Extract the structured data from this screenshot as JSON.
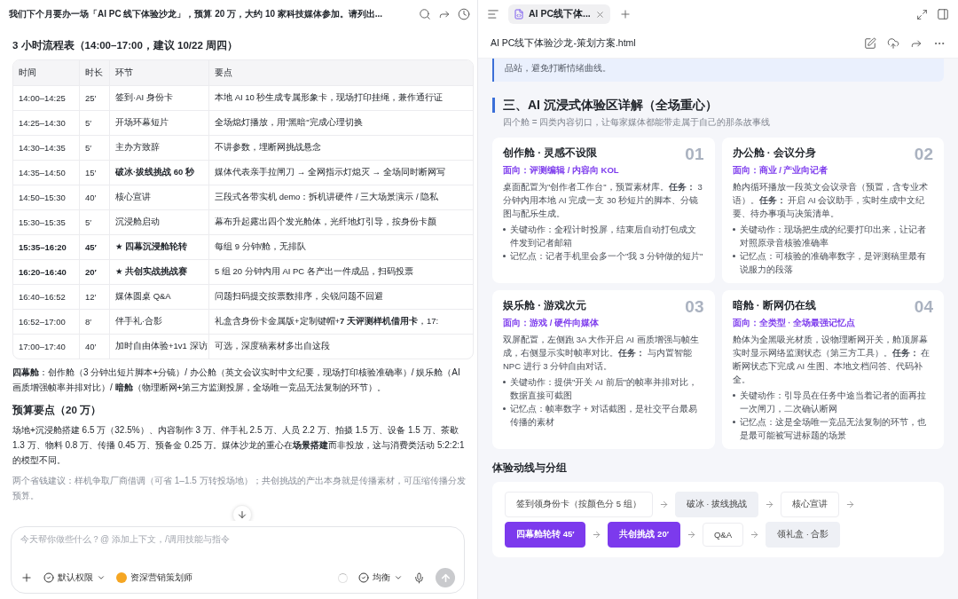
{
  "chat": {
    "title": "我们下个月要办一场「AI PC 线下体验沙龙」，预算 20 万，大约 10 家科技媒体参加。请列出...",
    "schedule_heading": "3 小时流程表（14:00–17:00，建议 10/22 周四）",
    "table": {
      "columns": [
        "时间",
        "时长",
        "环节",
        "要点"
      ],
      "rows": [
        {
          "time": "14:00–14:25",
          "duration": "25′",
          "step": "签到·AI 身份卡",
          "points": "本地 AI 10 秒生成专属形象卡，现场打印挂绳，兼作通行证",
          "highlight": false,
          "step_bold": false
        },
        {
          "time": "14:25–14:30",
          "duration": "5′",
          "step": "开场环幕短片",
          "points": "全场熄灯播放，用\"黑暗\"完成心理切换",
          "highlight": false,
          "step_bold": false
        },
        {
          "time": "14:30–14:35",
          "duration": "5′",
          "step": "主办方致辞",
          "points": "不讲参数，埋断网挑战悬念",
          "highlight": false,
          "step_bold": false
        },
        {
          "time": "14:35–14:50",
          "duration": "15′",
          "step": "破冰·拔线挑战 60 秒",
          "points": "媒体代表亲手拉闸刀 → 全网指示灯熄灭 → 全场同时断网写",
          "highlight": false,
          "step_bold": true
        },
        {
          "time": "14:50–15:30",
          "duration": "40′",
          "step": "核心宣讲",
          "points": "三段式各带实机 demo：拆机讲硬件 / 三大场景演示 / 隐私",
          "highlight": false,
          "step_bold": false
        },
        {
          "time": "15:30–15:35",
          "duration": "5′",
          "step": "沉浸舱启动",
          "points": "幕布升起露出四个发光舱体，光纤地灯引导，按身份卡颜",
          "highlight": false,
          "step_bold": false
        },
        {
          "time": "15:35–16:20",
          "duration": "45′",
          "step": "★ 四幕沉浸舱轮转",
          "points": "每组 9 分钟/舱，无排队",
          "highlight": true,
          "step_bold": true
        },
        {
          "time": "16:20–16:40",
          "duration": "20′",
          "step": "★ 共创实战挑战赛",
          "points": "5 组 20 分钟内用 AI PC 各产出一件成品，扫码投票",
          "highlight": true,
          "step_bold": true
        },
        {
          "time": "16:40–16:52",
          "duration": "12′",
          "step": "媒体圆桌 Q&A",
          "points": "问题扫码提交按票数排序，尖锐问题不回避",
          "highlight": false,
          "step_bold": false
        },
        {
          "time": "16:52–17:00",
          "duration": "8′",
          "step": "伴手礼·合影",
          "points": "礼盒含身份卡金属版+定制键帽+**7 天评测样机借用卡**，17:",
          "highlight": false,
          "step_bold": false
        },
        {
          "time": "17:00–17:40",
          "duration": "40′",
          "step": "加时自由体验+1v1 深访",
          "points": "可选，深度稿素材多出自这段",
          "highlight": false,
          "step_bold": false
        }
      ]
    },
    "cabins_note": "**四幕舱**：创作舱（3 分钟出短片脚本+分镜）/ 办公舱（英文会议实时中文纪要，现场打印核验准确率）/ 娱乐舱（AI 画质增强帧率并排对比）/ **暗舱**（物理断网+第三方监测投屏，全场唯一竞品无法复制的环节）。",
    "budget_heading": "预算要点（20 万）",
    "budget_text": "场地+沉浸舱搭建 6.5 万（32.5%）、内容制作 3 万、伴手礼 2.5 万、人员 2.2 万、拍摄 1.5 万、设备 1.5 万、茶歇 1.3 万、物料 0.8 万、传播 0.45 万、预备金 0.25 万。媒体沙龙的重心在**场景搭建**而非投放，这与消费类活动 5:2:2:1 的模型不同。",
    "tip_text": "两个省钱建议：样机争取厂商借调（可省 1–1.5 万转投场地）；共创挑战的产出本身就是传播素材，可压缩传播分发预算。",
    "input": {
      "placeholder": "今天帮你做些什么？@ 添加上下文，/调用技能与指令",
      "permission": "默认权限",
      "agent": "资深营销策划师",
      "mode": "均衡"
    }
  },
  "viewer": {
    "tabs": [
      {
        "label": "AI PC线下体...",
        "selected": true
      }
    ],
    "file_name": "AI PC线下体验沙龙-策划方案.html",
    "callout": "品站，避免打断情绪曲线。",
    "section_title": "三、AI 沉浸式体验区详解（全场重心）",
    "section_subtitle": "四个舱 = 四类内容切口，让每家媒体都能带走属于自己的那条故事线",
    "cards": [
      {
        "title": "创作舱 · 灵感不设限",
        "number": "01",
        "audience": "面向：评测编辑 / 内容向 KOL",
        "body": "桌面配置为\"创作者工作台\"，预置素材库。**任务：** 3 分钟内用本地 AI 完成一支 30 秒短片的脚本、分镜图与配乐生成。",
        "bullets": [
          "关键动作：全程计时投屏，结束后自动打包成文件发到记者邮箱",
          "记忆点：记者手机里会多一个\"我 3 分钟做的短片\""
        ]
      },
      {
        "title": "办公舱 · 会议分身",
        "number": "02",
        "audience": "面向：商业 / 产业向记者",
        "body": "舱内循环播放一段英文会议录音（预置，含专业术语）。**任务：** 开启 AI 会议助手，实时生成中文纪要、待办事项与决策清单。",
        "bullets": [
          "关键动作：现场把生成的纪要打印出来，让记者对照原录音核验准确率",
          "记忆点：可核验的准确率数字，是评测稿里最有说服力的段落"
        ]
      },
      {
        "title": "娱乐舱 · 游戏次元",
        "number": "03",
        "audience": "面向：游戏 / 硬件向媒体",
        "body": "双屏配置，左侧跑 3A 大作开启 AI 画质增强与帧生成，右侧显示实时帧率对比。**任务：** 与内置智能 NPC 进行 3 分钟自由对话。",
        "bullets": [
          "关键动作：提供\"开关 AI 前后\"的帧率并排对比，数据直接可截图",
          "记忆点：帧率数字 + 对话截图，是社交平台最易传播的素材"
        ]
      },
      {
        "title": "暗舱 · 断网仍在线",
        "number": "04",
        "audience": "面向：全类型 · 全场最强记忆点",
        "body": "舱体为全黑吸光材质，设物理断网开关，舱顶屏幕实时显示网络监测状态（第三方工具）。**任务：** 在断网状态下完成 AI 生图、本地文档问答、代码补全。",
        "bullets": [
          "关键动作：引导员在任务中途当着记者的面再拉一次闸刀，二次确认断网",
          "记忆点：这是全场唯一竞品无法复制的环节，也是最可能被写进标题的场景"
        ]
      }
    ],
    "flow_title": "体验动线与分组",
    "flow": [
      {
        "label": "签到领身份卡（按颜色分 5 组）",
        "kind": "plain"
      },
      {
        "label": "破冰 · 拔线挑战",
        "kind": "muted"
      },
      {
        "label": "核心宣讲",
        "kind": "plain"
      },
      {
        "label": "四幕舱轮转 45′",
        "kind": "highlight"
      },
      {
        "label": "共创挑战 20′",
        "kind": "highlight"
      },
      {
        "label": "Q&A",
        "kind": "plain"
      },
      {
        "label": "领礼盒 · 合影",
        "kind": "muted"
      }
    ]
  }
}
